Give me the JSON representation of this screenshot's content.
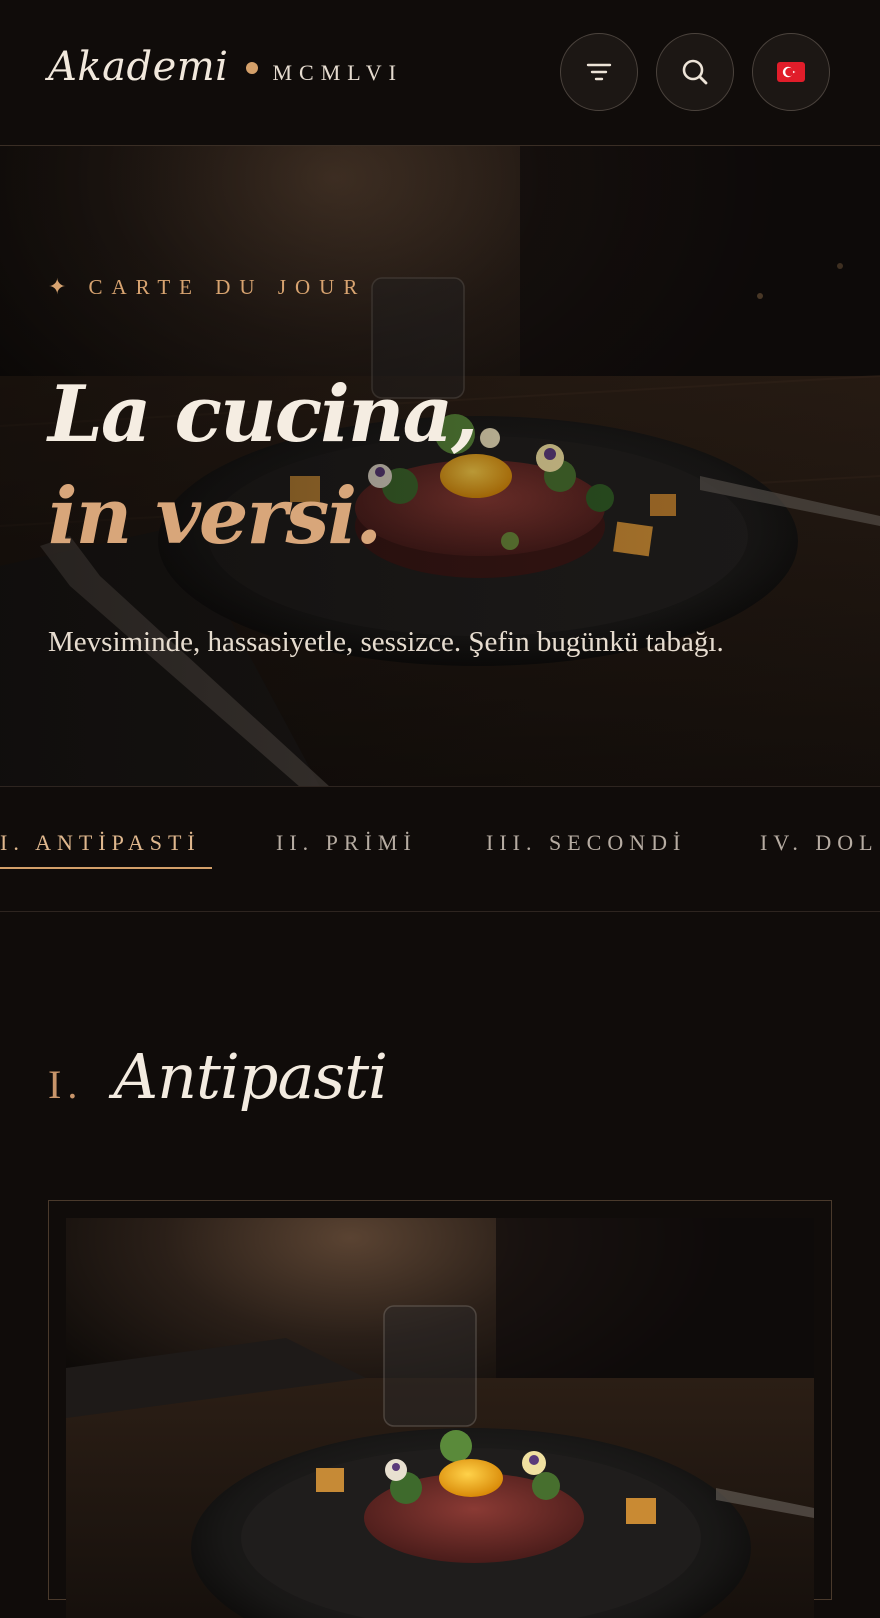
{
  "header": {
    "brand_name": "Akademi",
    "brand_sub": "MCMLVI",
    "buttons": {
      "filter_icon": "filter-icon",
      "search_icon": "search-icon",
      "language_icon": "turkey-flag-icon"
    }
  },
  "hero": {
    "eyebrow_symbol": "✦",
    "eyebrow": "CARTE DU JOUR",
    "title_line1": "La cucina,",
    "title_line2": "in versi.",
    "lead": "Mevsiminde, hassasiyetle, sessizce. Şefin bugünkü tabağı."
  },
  "tabs": [
    {
      "label": "I. ANTİPASTİ",
      "active": true
    },
    {
      "label": "II. PRİMİ",
      "active": false
    },
    {
      "label": "III. SECONDİ",
      "active": false
    },
    {
      "label": "IV. DOL",
      "active": false
    }
  ],
  "section": {
    "number": "I.",
    "title": "Antipasti"
  },
  "colors": {
    "background": "#100c0a",
    "accent": "#d4a06a",
    "text": "#f3ebe0"
  }
}
